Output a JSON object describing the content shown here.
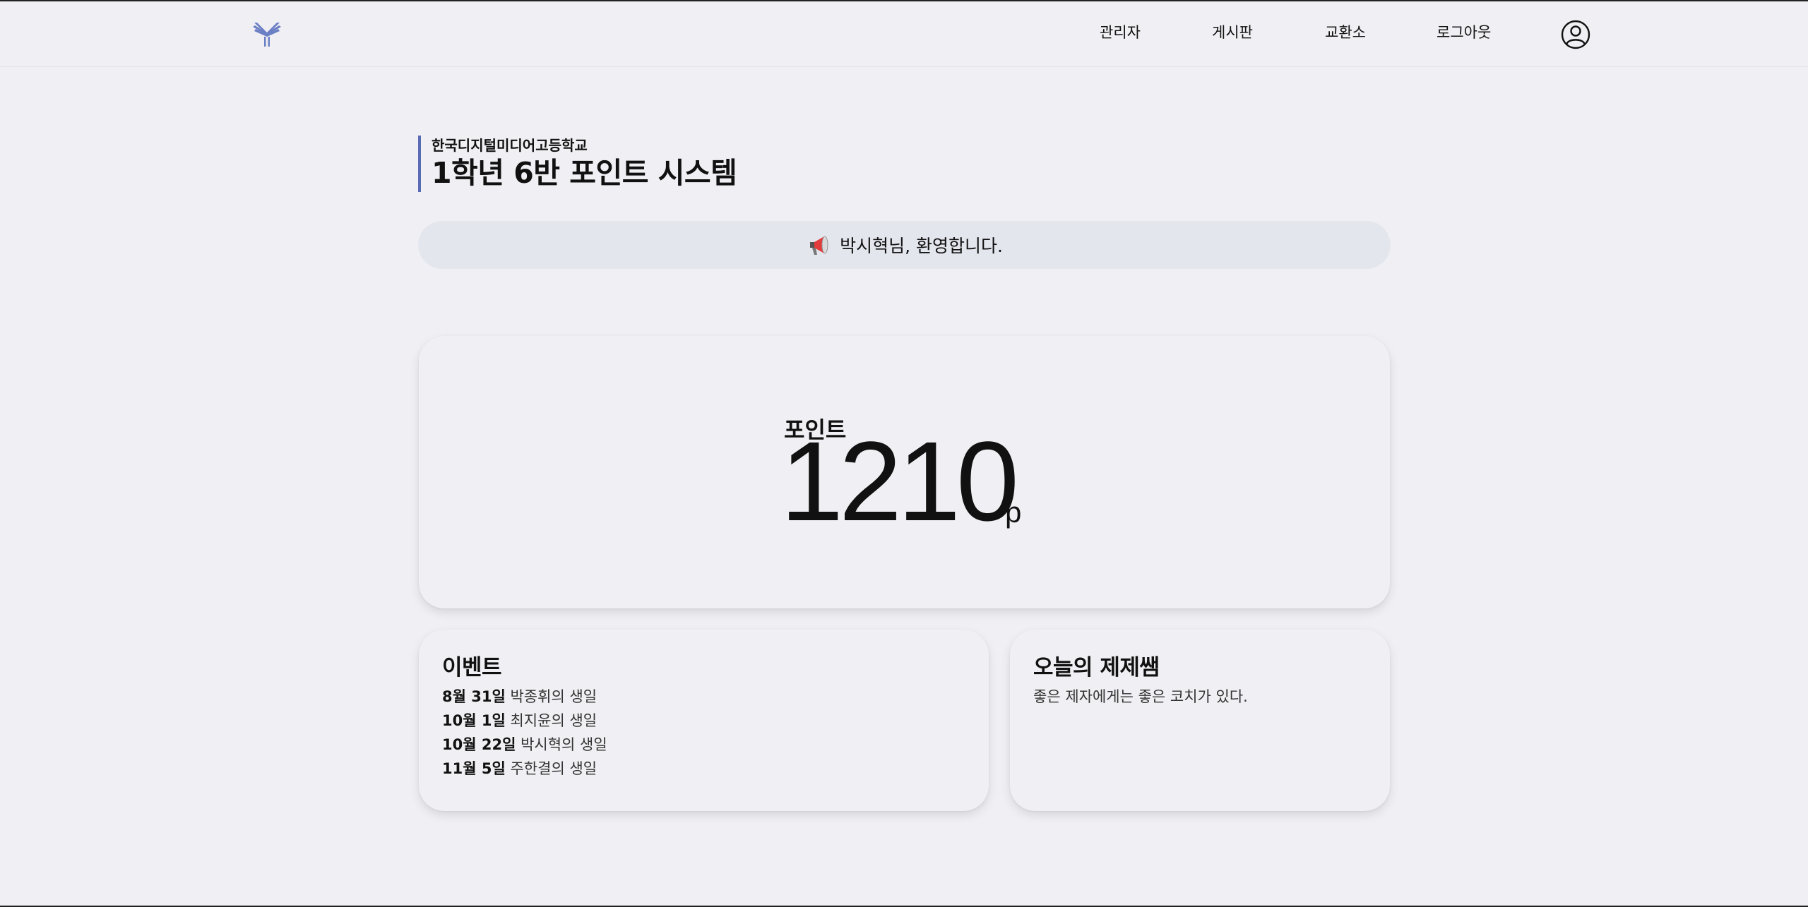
{
  "header": {
    "nav": {
      "admin": "관리자",
      "board": "게시판",
      "exchange": "교환소",
      "logout": "로그아웃"
    }
  },
  "title": {
    "school": "한국디지털미디어고등학교",
    "system": "1학년 6반 포인트 시스템"
  },
  "welcome": {
    "message": "박시혁님, 환영합니다."
  },
  "points": {
    "label": "포인트",
    "value": "1210",
    "unit": "p"
  },
  "events": {
    "title": "이벤트",
    "items": [
      {
        "date": "8월 31일",
        "desc": "박종휘의 생일"
      },
      {
        "date": "10월 1일",
        "desc": "최지윤의 생일"
      },
      {
        "date": "10월 22일",
        "desc": "박시혁의 생일"
      },
      {
        "date": "11월 5일",
        "desc": "주한결의 생일"
      }
    ]
  },
  "quote": {
    "title": "오늘의 제제쌤",
    "text": "좋은 제자에게는 좋은 코치가 있다."
  },
  "colors": {
    "accent": "#5a6bb5",
    "background": "#f0f0f4",
    "banner": "#e4e6ee"
  },
  "icons": {
    "logo": "winged-logo-icon",
    "profile": "user-circle-icon",
    "megaphone": "megaphone-icon"
  }
}
